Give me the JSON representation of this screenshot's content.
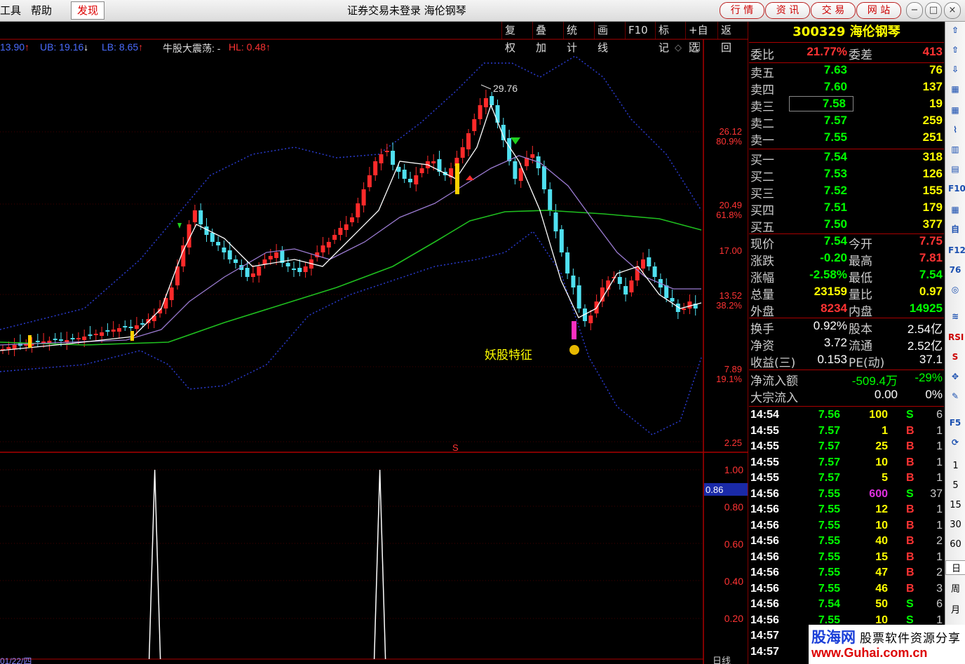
{
  "window": {
    "menu": [
      "工具",
      "帮助"
    ],
    "menu_active": "发现",
    "title": "证券交易未登录  海伦钢琴",
    "top_buttons": [
      "行 情",
      "资 讯",
      "交 易",
      "网 站"
    ],
    "window_buttons": [
      "?",
      "−",
      "□",
      "×"
    ]
  },
  "toolbar": [
    "复权",
    "叠加",
    "统计",
    "画线",
    "F10",
    "标记",
    "+自选",
    "返回"
  ],
  "indicators": {
    "mid": "13.90",
    "ub": "UB: 19.16",
    "lb": "LB: 8.65",
    "name": "牛股大震荡: -",
    "hl": "HL: 0.48"
  },
  "chart_data": {
    "type": "candlestick",
    "price_axis": [
      "26.12",
      "80.9%",
      "20.49",
      "61.8%",
      "17.00",
      "13.52",
      "38.2%",
      "7.89",
      "19.1%",
      "2.25"
    ],
    "peak_label": "29.76",
    "annotation": "妖股特征",
    "date_label": "01/22/四",
    "sub_axis": [
      "1.00",
      "0.80",
      "0.60",
      "0.40",
      "0.20"
    ],
    "sub_current": "0.86",
    "sub_x_label": "日线",
    "sub_spikes": [
      0.22,
      0.54
    ]
  },
  "quote": {
    "code_name": "300329 海伦钢琴",
    "weibi_label": "委比",
    "weibi": "21.77%",
    "weicha_label": "委差",
    "weicha": "413",
    "asks": [
      {
        "label": "卖五",
        "price": "7.63",
        "vol": "76"
      },
      {
        "label": "卖四",
        "price": "7.60",
        "vol": "137"
      },
      {
        "label": "卖三",
        "price": "7.58",
        "vol": "19"
      },
      {
        "label": "卖二",
        "price": "7.57",
        "vol": "259"
      },
      {
        "label": "卖一",
        "price": "7.55",
        "vol": "251"
      }
    ],
    "bids": [
      {
        "label": "买一",
        "price": "7.54",
        "vol": "318"
      },
      {
        "label": "买二",
        "price": "7.53",
        "vol": "126"
      },
      {
        "label": "买三",
        "price": "7.52",
        "vol": "155"
      },
      {
        "label": "买四",
        "price": "7.51",
        "vol": "179"
      },
      {
        "label": "买五",
        "price": "7.50",
        "vol": "377"
      }
    ],
    "stats": [
      {
        "l1": "现价",
        "v1": "7.54",
        "l2": "今开",
        "v2": "7.75"
      },
      {
        "l1": "涨跌",
        "v1": "-0.20",
        "l2": "最高",
        "v2": "7.81"
      },
      {
        "l1": "涨幅",
        "v1": "-2.58%",
        "l2": "最低",
        "v2": "7.54"
      },
      {
        "l1": "总量",
        "v1": "23159",
        "l2": "量比",
        "v2": "0.97"
      },
      {
        "l1": "外盘",
        "v1": "8234",
        "l2": "内盘",
        "v2": "14925"
      }
    ],
    "stats2": [
      {
        "l1": "换手",
        "v1": "0.92%",
        "l2": "股本",
        "v2": "2.54亿"
      },
      {
        "l1": "净资",
        "v1": "3.72",
        "l2": "流通",
        "v2": "2.52亿"
      },
      {
        "l1": "收益(三)",
        "v1": "0.153",
        "l2": "PE(动)",
        "v2": "37.1"
      }
    ],
    "flow": [
      {
        "l": "净流入额",
        "v": "-509.4万",
        "p": "-29%"
      },
      {
        "l": "大宗流入",
        "v": "0.00",
        "p": "0%"
      }
    ],
    "ticks": [
      {
        "t": "14:54",
        "p": "7.56",
        "v": "100",
        "bs": "S",
        "n": "6"
      },
      {
        "t": "14:55",
        "p": "7.57",
        "v": "1",
        "bs": "B",
        "n": "1"
      },
      {
        "t": "14:55",
        "p": "7.57",
        "v": "25",
        "bs": "B",
        "n": "1"
      },
      {
        "t": "14:55",
        "p": "7.57",
        "v": "10",
        "bs": "B",
        "n": "1"
      },
      {
        "t": "14:55",
        "p": "7.57",
        "v": "5",
        "bs": "B",
        "n": "1"
      },
      {
        "t": "14:56",
        "p": "7.55",
        "v": "600",
        "bs": "S",
        "n": "37"
      },
      {
        "t": "14:56",
        "p": "7.55",
        "v": "12",
        "bs": "B",
        "n": "1"
      },
      {
        "t": "14:56",
        "p": "7.55",
        "v": "10",
        "bs": "B",
        "n": "1"
      },
      {
        "t": "14:56",
        "p": "7.55",
        "v": "40",
        "bs": "B",
        "n": "2"
      },
      {
        "t": "14:56",
        "p": "7.55",
        "v": "15",
        "bs": "B",
        "n": "1"
      },
      {
        "t": "14:56",
        "p": "7.55",
        "v": "47",
        "bs": "B",
        "n": "2"
      },
      {
        "t": "14:56",
        "p": "7.55",
        "v": "46",
        "bs": "B",
        "n": "3"
      },
      {
        "t": "14:56",
        "p": "7.54",
        "v": "50",
        "bs": "S",
        "n": "6"
      },
      {
        "t": "14:56",
        "p": "7.55",
        "v": "10",
        "bs": "S",
        "n": "1"
      },
      {
        "t": "14:57",
        "p": "",
        "v": "",
        "bs": "",
        "n": ""
      },
      {
        "t": "14:57",
        "p": "",
        "v": "",
        "bs": "",
        "n": ""
      }
    ]
  },
  "side_icons": [
    "⇧",
    "⇧",
    "⇩",
    "▦",
    "▦",
    "⌇",
    "▥",
    "▤",
    "F10",
    "▦",
    "自",
    "F12",
    "76",
    "◎",
    "≋",
    "RSI",
    "S",
    "✥",
    "✎",
    "F5",
    "⟳"
  ],
  "side_periods": [
    "1",
    "5",
    "15",
    "30",
    "60",
    "日",
    "周",
    "月"
  ],
  "watermark": {
    "brand": "股海网",
    "slogan": "股票软件资源分享",
    "url": "www.Guhai.com.cn"
  }
}
